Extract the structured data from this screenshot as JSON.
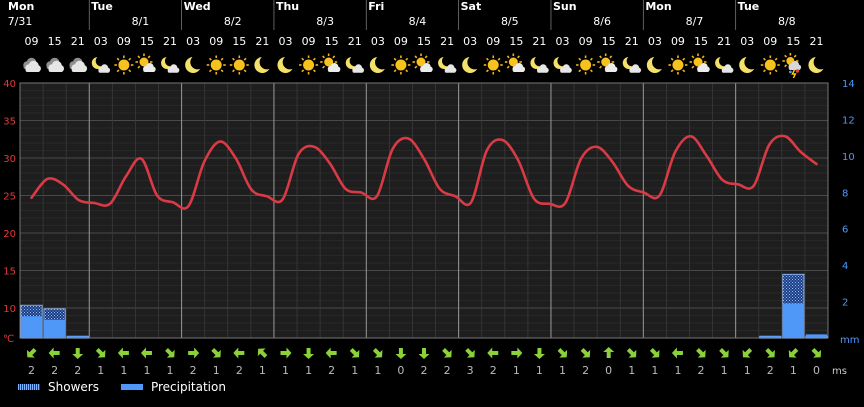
{
  "legend": {
    "showers": "Showers",
    "precipitation": "Precipitation"
  },
  "units": {
    "temp": "℃",
    "precip": "mm",
    "wind": "ms"
  },
  "colors": {
    "temp_line": "#d93a45",
    "temp_axis": "#e03a3a",
    "precip_axis": "#4f98f7",
    "precipitation": "#4f98f7",
    "showers": "#7fb0ff",
    "wind_arrow": "#8bd13a",
    "grid": "#3a3a3a",
    "background": "#000000",
    "plot_bg": "#1e1e1e"
  },
  "days": [
    {
      "name": "Mon",
      "date": "7/31"
    },
    {
      "name": "Tue",
      "date": "8/1"
    },
    {
      "name": "Wed",
      "date": "8/2"
    },
    {
      "name": "Thu",
      "date": "8/3"
    },
    {
      "name": "Fri",
      "date": "8/4"
    },
    {
      "name": "Sat",
      "date": "8/5"
    },
    {
      "name": "Sun",
      "date": "8/6"
    },
    {
      "name": "Mon",
      "date": "8/7"
    },
    {
      "name": "Tue",
      "date": "8/8"
    }
  ],
  "hours": [
    "09",
    "15",
    "21",
    "03",
    "09",
    "15",
    "21",
    "03",
    "09",
    "15",
    "21",
    "03",
    "09",
    "15",
    "21",
    "03",
    "09",
    "15",
    "21",
    "03",
    "09",
    "15",
    "21",
    "03",
    "09",
    "15",
    "21",
    "03",
    "09",
    "15",
    "21",
    "03",
    "09",
    "15",
    "21"
  ],
  "weather_icons": [
    "cloudy-icon",
    "cloudy-icon",
    "cloudy-icon",
    "partly-cloudy-night-icon",
    "sunny-icon",
    "partly-cloudy-icon",
    "partly-cloudy-night-icon",
    "clear-night-icon",
    "sunny-icon",
    "sunny-icon",
    "clear-night-icon",
    "clear-night-icon",
    "sunny-icon",
    "partly-cloudy-icon",
    "partly-cloudy-night-icon",
    "clear-night-icon",
    "sunny-icon",
    "partly-cloudy-icon",
    "partly-cloudy-night-icon",
    "clear-night-icon",
    "sunny-icon",
    "partly-cloudy-icon",
    "partly-cloudy-night-icon",
    "partly-cloudy-night-icon",
    "sunny-icon",
    "partly-cloudy-icon",
    "partly-cloudy-night-icon",
    "clear-night-icon",
    "sunny-icon",
    "partly-cloudy-icon",
    "partly-cloudy-night-icon",
    "clear-night-icon",
    "sunny-icon",
    "rain-thunder-icon",
    "clear-night-icon"
  ],
  "chart_data": {
    "type": "line",
    "x": [
      "7/31 09",
      "7/31 15",
      "7/31 21",
      "8/1 03",
      "8/1 09",
      "8/1 15",
      "8/1 21",
      "8/2 03",
      "8/2 09",
      "8/2 15",
      "8/2 21",
      "8/3 03",
      "8/3 09",
      "8/3 15",
      "8/3 21",
      "8/4 03",
      "8/4 09",
      "8/4 15",
      "8/4 21",
      "8/5 03",
      "8/5 09",
      "8/5 15",
      "8/5 21",
      "8/6 03",
      "8/6 09",
      "8/6 15",
      "8/6 21",
      "8/7 03",
      "8/7 09",
      "8/7 15",
      "8/7 21",
      "8/8 03",
      "8/8 09",
      "8/8 15",
      "8/8 21"
    ],
    "temperature": [
      24.7,
      27.2,
      26.5,
      24.4,
      24.0,
      23.9,
      27.5,
      29.9,
      25.0,
      24.1,
      23.6,
      29.5,
      32.2,
      30.0,
      25.8,
      24.9,
      24.5,
      30.5,
      31.5,
      29.3,
      25.9,
      25.4,
      24.9,
      31.2,
      32.6,
      29.9,
      25.9,
      24.9,
      24.1,
      31.0,
      32.4,
      29.7,
      24.6,
      23.9,
      24.0,
      29.9,
      31.5,
      29.5,
      26.3,
      25.4,
      25.0,
      30.8,
      32.9,
      30.3,
      27.1,
      26.5,
      26.3,
      31.8,
      32.9,
      30.8,
      29.2
    ],
    "precipitation": [
      1.2,
      1.0,
      0.1,
      0,
      0,
      0,
      0,
      0,
      0,
      0,
      0,
      0,
      0,
      0,
      0,
      0,
      0,
      0,
      0,
      0,
      0,
      0,
      0,
      0,
      0,
      0,
      0,
      0,
      0,
      0,
      0,
      0,
      0.1,
      1.9,
      0.2
    ],
    "showers": [
      1.8,
      1.6,
      0.1,
      0,
      0,
      0,
      0,
      0,
      0,
      0,
      0,
      0,
      0,
      0,
      0,
      0,
      0,
      0,
      0,
      0,
      0,
      0,
      0,
      0,
      0,
      0,
      0,
      0,
      0,
      0,
      0,
      0,
      0.1,
      3.5,
      0.1
    ],
    "wind_speed": [
      2,
      2,
      2,
      1,
      1,
      1,
      1,
      2,
      1,
      2,
      1,
      1,
      1,
      2,
      1,
      1,
      0,
      2,
      2,
      3,
      2,
      1,
      1,
      1,
      2,
      0,
      1,
      1,
      1,
      2,
      1,
      1,
      2,
      1,
      0
    ],
    "wind_rotation": [
      135,
      180,
      90,
      45,
      180,
      180,
      45,
      0,
      45,
      180,
      225,
      0,
      90,
      180,
      45,
      45,
      90,
      90,
      45,
      45,
      180,
      0,
      90,
      45,
      45,
      270,
      45,
      45,
      180,
      45,
      45,
      135,
      45,
      135,
      45
    ],
    "y_temp": {
      "ticks": [
        10,
        15,
        20,
        25,
        30,
        35,
        40
      ],
      "range": [
        6,
        40
      ]
    },
    "y_precip": {
      "ticks": [
        2,
        4,
        6,
        8,
        10,
        12,
        14
      ],
      "range": [
        0,
        14
      ]
    }
  }
}
